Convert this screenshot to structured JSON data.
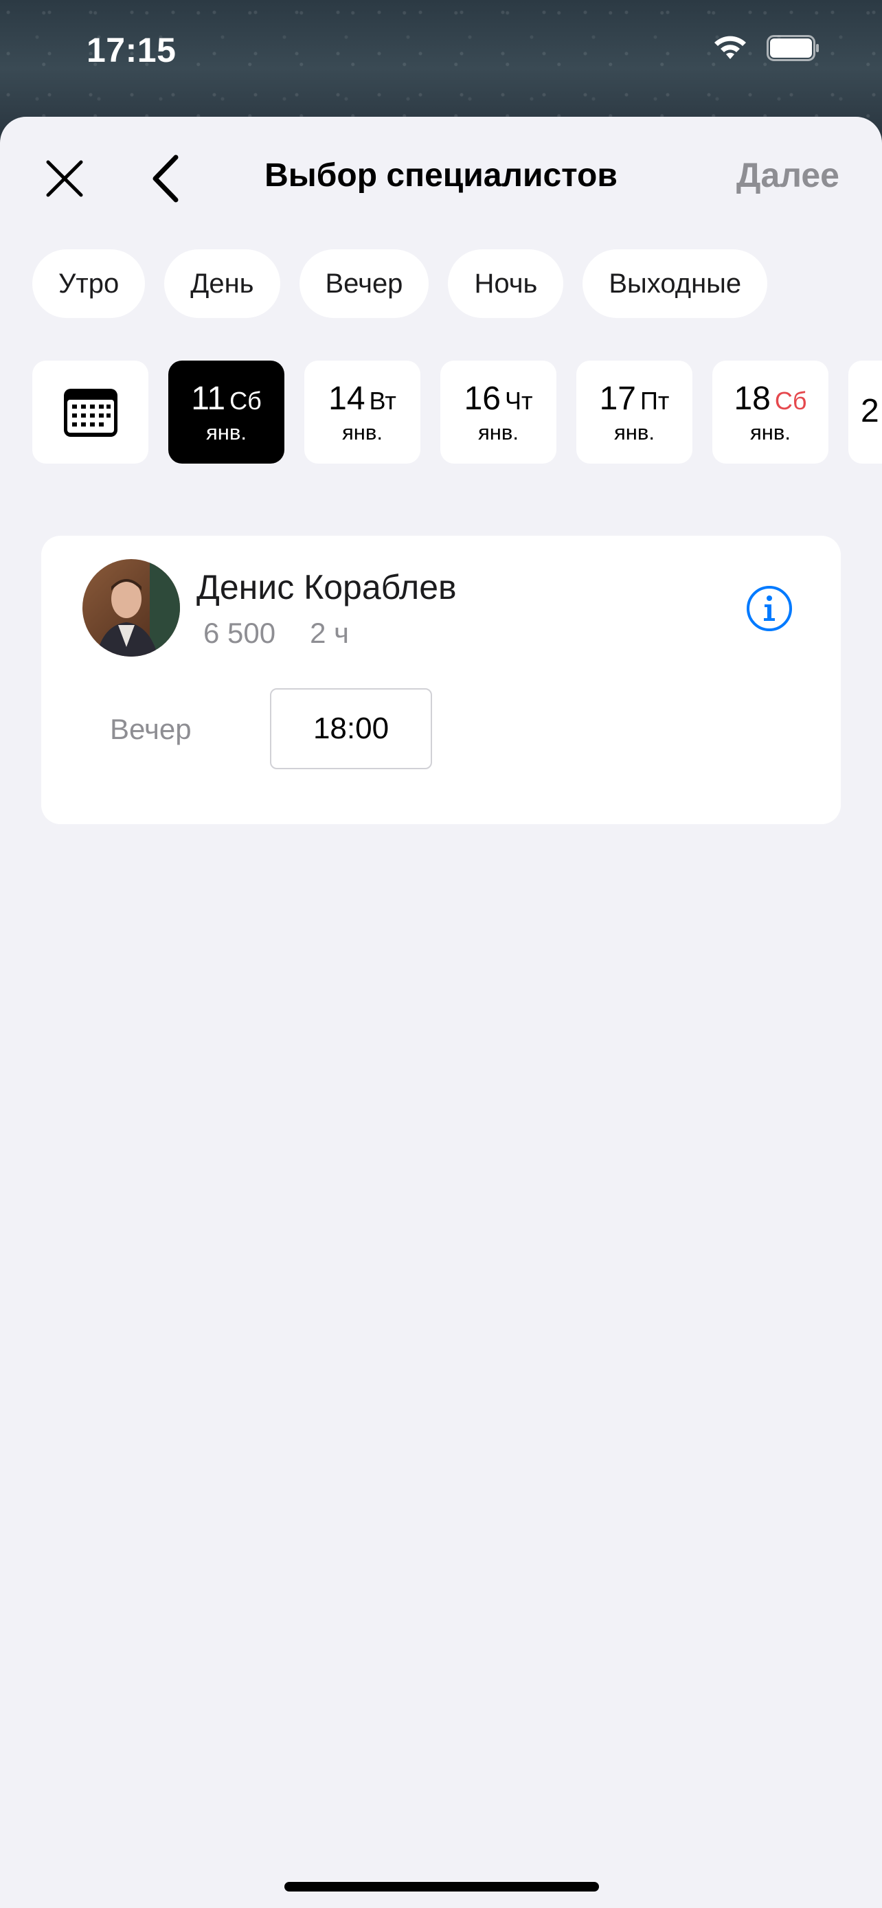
{
  "status_bar": {
    "time": "17:15",
    "wifi_icon": "wifi-icon",
    "battery_icon": "battery-icon"
  },
  "nav": {
    "title": "Выбор специалистов",
    "next_label": "Далее",
    "close_icon": "close-icon",
    "back_icon": "chevron-left-icon"
  },
  "filters": [
    "Утро",
    "День",
    "Вечер",
    "Ночь",
    "Выходные"
  ],
  "dates": [
    {
      "day": "11",
      "weekday": "Сб",
      "month": "янв.",
      "selected": true,
      "weekend": false
    },
    {
      "day": "14",
      "weekday": "Вт",
      "month": "янв.",
      "selected": false,
      "weekend": false
    },
    {
      "day": "16",
      "weekday": "Чт",
      "month": "янв.",
      "selected": false,
      "weekend": false
    },
    {
      "day": "17",
      "weekday": "Пт",
      "month": "янв.",
      "selected": false,
      "weekend": false
    },
    {
      "day": "18",
      "weekday": "Сб",
      "month": "янв.",
      "selected": false,
      "weekend": true
    },
    {
      "day": "2",
      "weekday": "",
      "month": "",
      "selected": false,
      "weekend": false
    }
  ],
  "specialist": {
    "name": "Денис Кораблев",
    "price": "6 500",
    "duration": "2 ч",
    "slot_label": "Вечер",
    "slot_time": "18:00"
  },
  "colors": {
    "accent": "#007aff",
    "weekend": "#e5484d",
    "muted": "#8e8e93"
  }
}
